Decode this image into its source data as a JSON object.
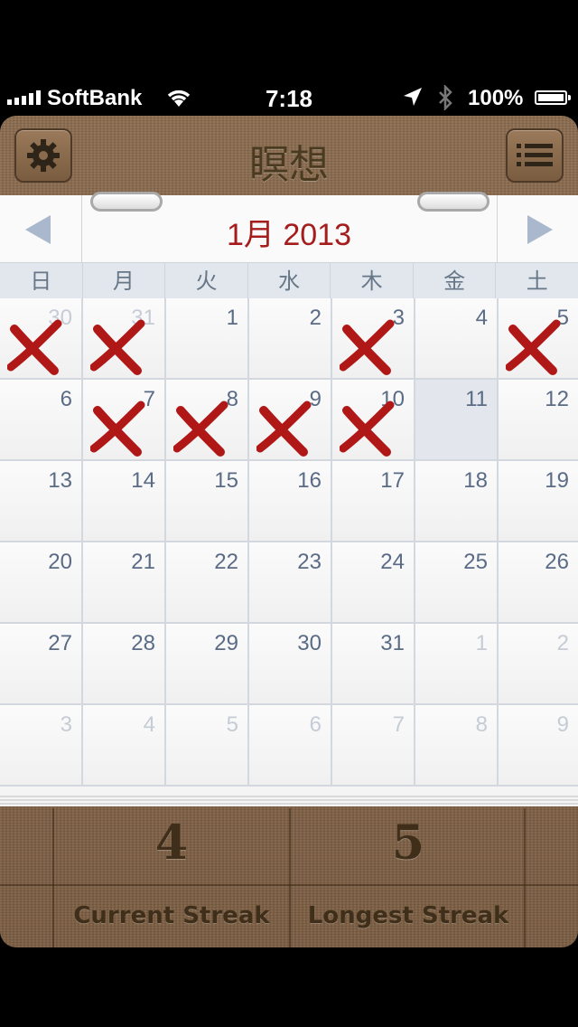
{
  "status_bar": {
    "carrier": "SoftBank",
    "time": "7:18",
    "battery": "100%"
  },
  "app": {
    "title": "瞑想",
    "settings_icon": "gear-icon",
    "list_icon": "list-icon"
  },
  "calendar": {
    "month_title": "1月 2013",
    "weekdays": [
      "日",
      "月",
      "火",
      "水",
      "木",
      "金",
      "土"
    ],
    "weeks": [
      [
        {
          "day": "30",
          "faded": true,
          "marked": true
        },
        {
          "day": "31",
          "faded": true,
          "marked": true
        },
        {
          "day": "1",
          "faded": false,
          "marked": false
        },
        {
          "day": "2",
          "faded": false,
          "marked": false
        },
        {
          "day": "3",
          "faded": false,
          "marked": true
        },
        {
          "day": "4",
          "faded": false,
          "marked": false
        },
        {
          "day": "5",
          "faded": false,
          "marked": true
        }
      ],
      [
        {
          "day": "6",
          "faded": false,
          "marked": false
        },
        {
          "day": "7",
          "faded": false,
          "marked": true
        },
        {
          "day": "8",
          "faded": false,
          "marked": true
        },
        {
          "day": "9",
          "faded": false,
          "marked": true
        },
        {
          "day": "10",
          "faded": false,
          "marked": true
        },
        {
          "day": "11",
          "faded": false,
          "marked": false,
          "today": true
        },
        {
          "day": "12",
          "faded": false,
          "marked": false
        }
      ],
      [
        {
          "day": "13",
          "faded": false,
          "marked": false
        },
        {
          "day": "14",
          "faded": false,
          "marked": false
        },
        {
          "day": "15",
          "faded": false,
          "marked": false
        },
        {
          "day": "16",
          "faded": false,
          "marked": false
        },
        {
          "day": "17",
          "faded": false,
          "marked": false
        },
        {
          "day": "18",
          "faded": false,
          "marked": false
        },
        {
          "day": "19",
          "faded": false,
          "marked": false
        }
      ],
      [
        {
          "day": "20",
          "faded": false,
          "marked": false
        },
        {
          "day": "21",
          "faded": false,
          "marked": false
        },
        {
          "day": "22",
          "faded": false,
          "marked": false
        },
        {
          "day": "23",
          "faded": false,
          "marked": false
        },
        {
          "day": "24",
          "faded": false,
          "marked": false
        },
        {
          "day": "25",
          "faded": false,
          "marked": false
        },
        {
          "day": "26",
          "faded": false,
          "marked": false
        }
      ],
      [
        {
          "day": "27",
          "faded": false,
          "marked": false
        },
        {
          "day": "28",
          "faded": false,
          "marked": false
        },
        {
          "day": "29",
          "faded": false,
          "marked": false
        },
        {
          "day": "30",
          "faded": false,
          "marked": false
        },
        {
          "day": "31",
          "faded": false,
          "marked": false
        },
        {
          "day": "1",
          "faded": true,
          "marked": false
        },
        {
          "day": "2",
          "faded": true,
          "marked": false
        }
      ],
      [
        {
          "day": "3",
          "faded": true,
          "marked": false
        },
        {
          "day": "4",
          "faded": true,
          "marked": false
        },
        {
          "day": "5",
          "faded": true,
          "marked": false
        },
        {
          "day": "6",
          "faded": true,
          "marked": false
        },
        {
          "day": "7",
          "faded": true,
          "marked": false
        },
        {
          "day": "8",
          "faded": true,
          "marked": false
        },
        {
          "day": "9",
          "faded": true,
          "marked": false
        }
      ]
    ]
  },
  "stats": {
    "current_streak_value": "4",
    "current_streak_label": "Current Streak",
    "longest_streak_value": "5",
    "longest_streak_label": "Longest Streak"
  },
  "colors": {
    "month_title": "#a51c1c",
    "x_mark": "#b01717",
    "wood": "#7a5c41"
  }
}
